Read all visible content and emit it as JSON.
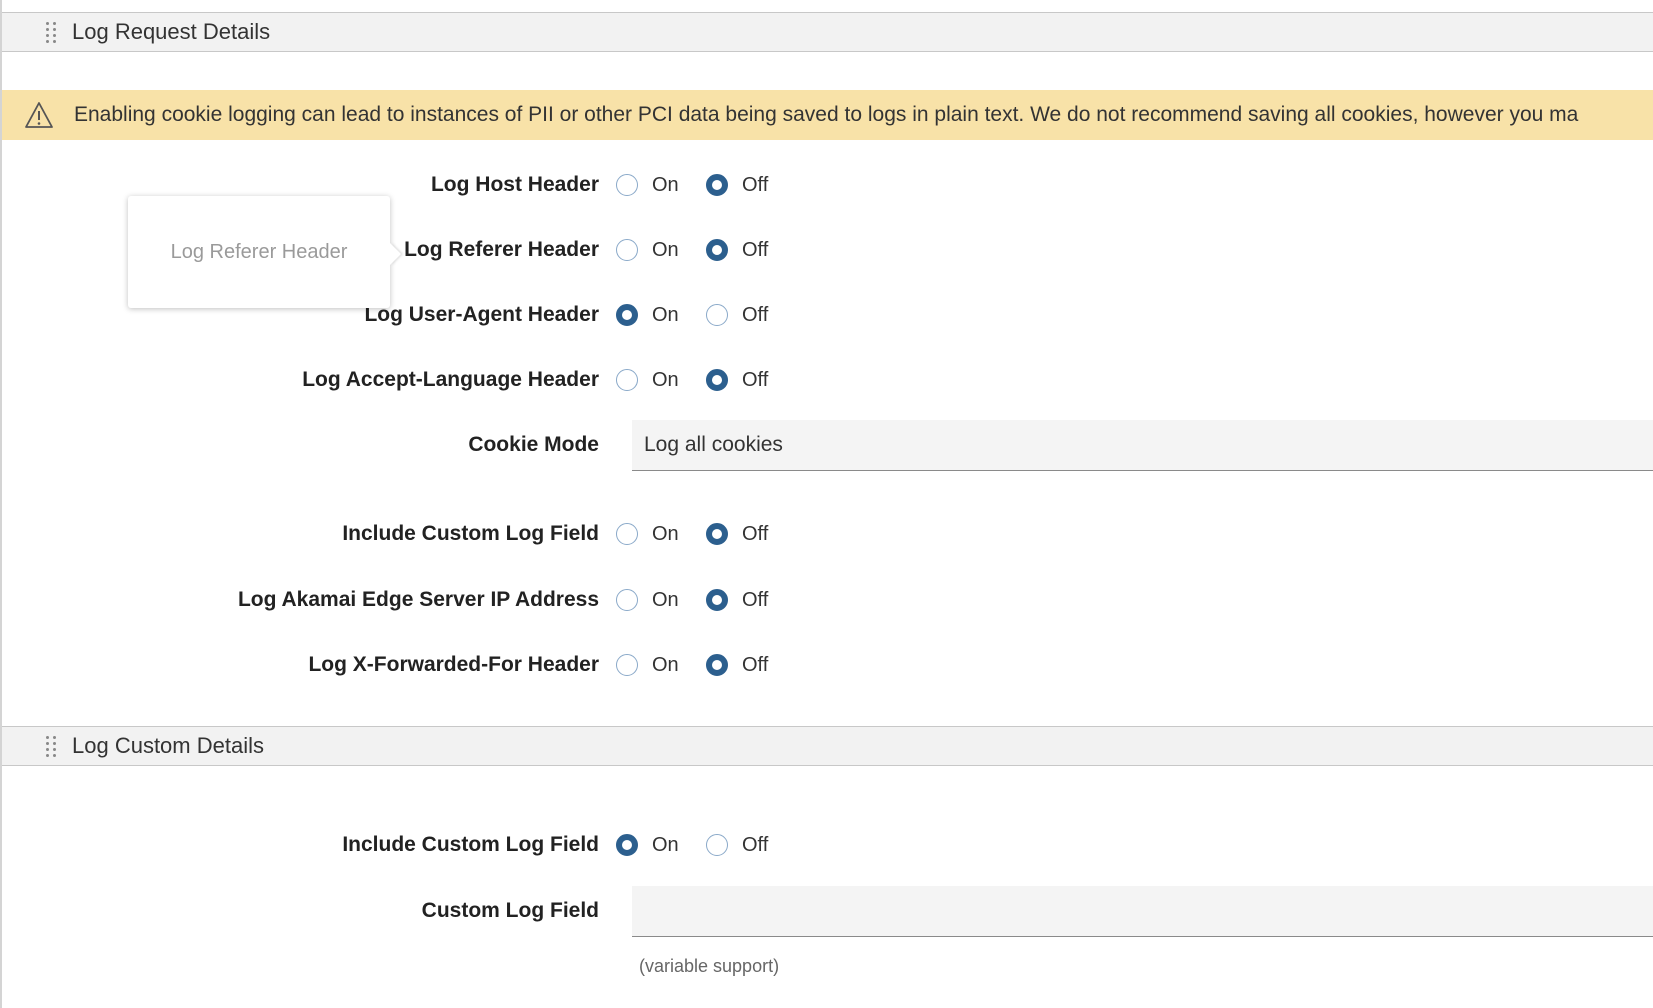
{
  "sections": {
    "request": {
      "title": "Log Request Details"
    },
    "custom": {
      "title": "Log Custom Details"
    }
  },
  "warning": {
    "text": "Enabling cookie logging can lead to instances of PII or other PCI data being saved to logs in plain text. We do not recommend saving all cookies, however you ma"
  },
  "tooltip": {
    "text": "Log Referer Header"
  },
  "radio_labels": {
    "on": "On",
    "off": "Off"
  },
  "fields": {
    "host": {
      "label": "Log Host Header",
      "value": "Off"
    },
    "referer": {
      "label": "Log Referer Header",
      "value": "Off"
    },
    "user_agent": {
      "label": "Log User-Agent Header",
      "value": "On"
    },
    "accept_language": {
      "label": "Log Accept-Language Header",
      "value": "Off"
    },
    "cookie_mode": {
      "label": "Cookie Mode",
      "value": "Log all cookies"
    },
    "include_custom_1": {
      "label": "Include Custom Log Field",
      "value": "Off"
    },
    "edge_ip": {
      "label": "Log Akamai Edge Server IP Address",
      "value": "Off"
    },
    "x_forwarded_for": {
      "label": "Log X-Forwarded-For Header",
      "value": "Off"
    },
    "include_custom_2": {
      "label": "Include Custom Log Field",
      "value": "On"
    },
    "custom_log_field": {
      "label": "Custom Log Field",
      "value": "",
      "hint": "(variable support)"
    }
  },
  "colors": {
    "warning_bg": "#f8e2a8",
    "radio_checked": "#2c5f8e",
    "section_header_bg": "#f2f2f2"
  },
  "icons": {
    "warning": "warning-triangle-icon",
    "drag": "drag-handle-icon"
  }
}
